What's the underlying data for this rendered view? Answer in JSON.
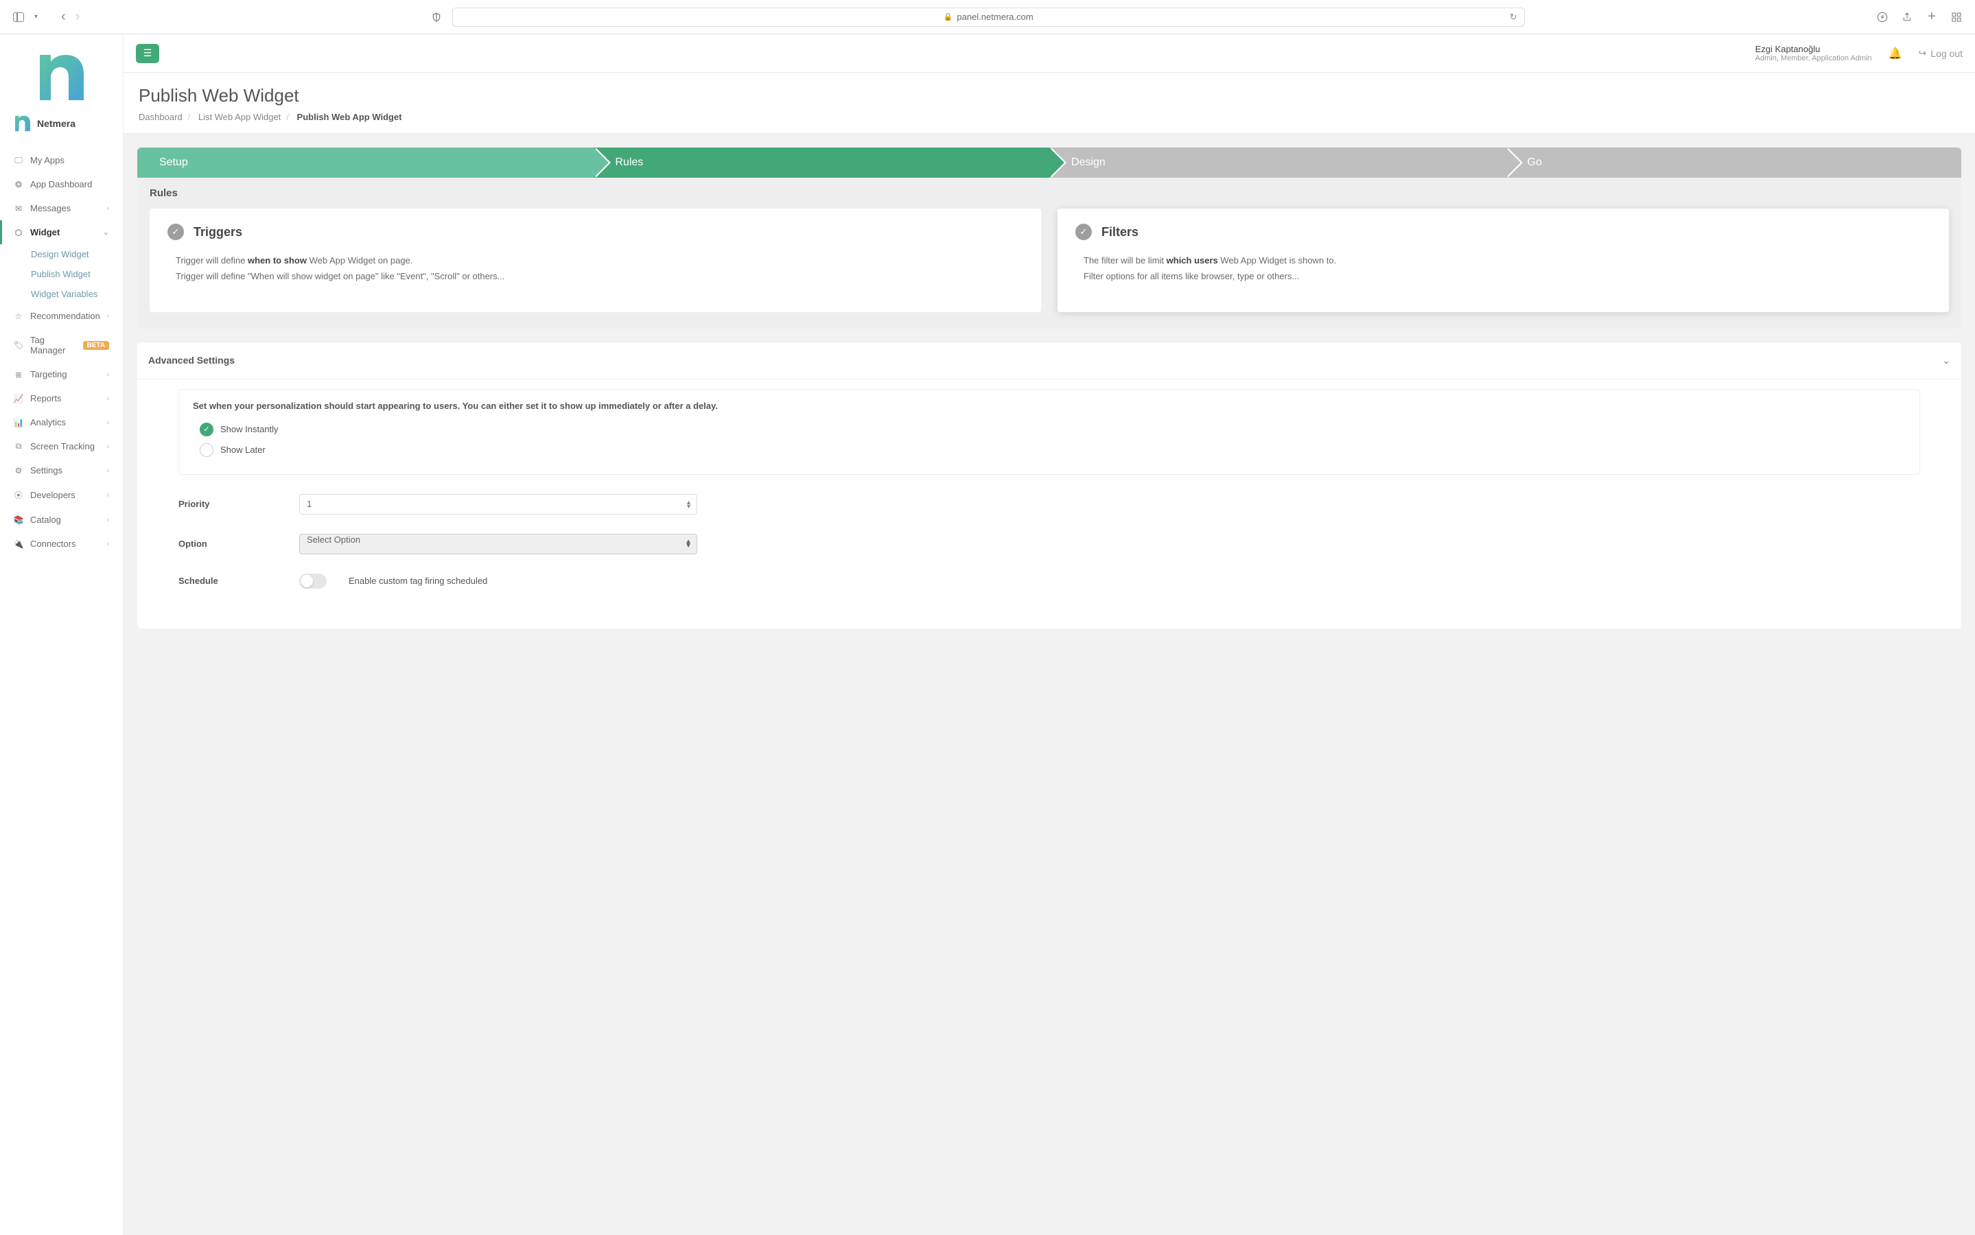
{
  "browser": {
    "url": "panel.netmera.com"
  },
  "brand": {
    "name": "Netmera"
  },
  "user": {
    "name": "Ezgi Kaptanoğlu",
    "roles": "Admin, Member, Application Admin",
    "logout": "Log out"
  },
  "sidebar": {
    "items": [
      {
        "label": "My Apps"
      },
      {
        "label": "App Dashboard"
      },
      {
        "label": "Messages",
        "expandable": true
      },
      {
        "label": "Widget",
        "expandable": true,
        "active": true
      },
      {
        "label": "Recommendation",
        "expandable": true
      },
      {
        "label": "Tag Manager",
        "badge": "BETA"
      },
      {
        "label": "Targeting",
        "expandable": true
      },
      {
        "label": "Reports",
        "expandable": true
      },
      {
        "label": "Analytics",
        "expandable": true
      },
      {
        "label": "Screen Tracking",
        "expandable": true
      },
      {
        "label": "Settings",
        "expandable": true
      },
      {
        "label": "Developers",
        "expandable": true
      },
      {
        "label": "Catalog",
        "expandable": true
      },
      {
        "label": "Connectors",
        "expandable": true
      }
    ],
    "widget_sub": [
      {
        "label": "Design Widget"
      },
      {
        "label": "Publish Widget"
      },
      {
        "label": "Widget Variables"
      }
    ]
  },
  "page": {
    "title": "Publish Web Widget",
    "crumb1": "Dashboard",
    "crumb2": "List Web App Widget",
    "crumb3": "Publish Web App Widget"
  },
  "steps": {
    "s1": "Setup",
    "s2": "Rules",
    "s3": "Design",
    "s4": "Go"
  },
  "rules": {
    "heading": "Rules",
    "triggers": {
      "title": "Triggers",
      "l1a": "Trigger will define ",
      "l1b": "when to show",
      "l1c": " Web App Widget on page.",
      "l2": "Trigger will define \"When will show widget on page\" like \"Event\", \"Scroll\" or others..."
    },
    "filters": {
      "title": "Filters",
      "l1a": "The filter will be limit ",
      "l1b": "which users",
      "l1c": " Web App Widget is shown to.",
      "l2": "Filter options for all items like browser, type or others..."
    }
  },
  "advanced": {
    "title": "Advanced Settings",
    "timing_desc": "Set when your personalization should start appearing to users. You can either set it to show up immediately or after a delay.",
    "opt_instant": "Show Instantly",
    "opt_later": "Show Later",
    "priority_label": "Priority",
    "priority_value": "1",
    "option_label": "Option",
    "option_value": "Select Option",
    "schedule_label": "Schedule",
    "schedule_text": "Enable custom tag firing scheduled"
  }
}
